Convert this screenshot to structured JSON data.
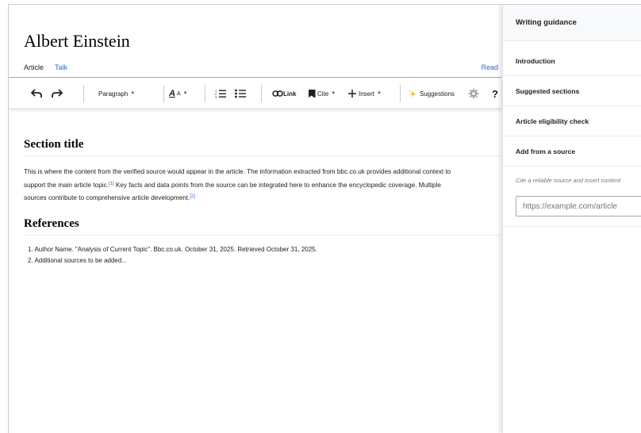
{
  "article": {
    "title": "Albert Einstein",
    "tabs": {
      "article": "Article",
      "talk": "Talk",
      "read": "Read"
    }
  },
  "toolbar": {
    "undo_icon": "undo-icon",
    "redo_icon": "redo-icon",
    "paragraph_label": "Paragraph",
    "text_style_label": "A",
    "text_style_small": "A",
    "link_label": "Link",
    "cite_label": "Cite",
    "insert_label": "Insert",
    "suggestions_label": "Suggestions",
    "help_label": "?"
  },
  "content": {
    "section_title": "Section title",
    "paragraph": {
      "line1": "This is where the content from the verified source would appear in the article. The information extracted from bbc.co.uk provides additional context to",
      "line2_a": "support the main article topic.",
      "ref1": "[1]",
      "line2_b": " Key facts and data points from the source can be integrated here to enhance the encyclopedic coverage. Multiple",
      "line3_a": "sources contribute to comprehensive article development.",
      "ref2": "[2]"
    },
    "references_title": "References",
    "references": [
      "1. Author Name. \"Analysis of Current Topic\". Bbc.co.uk. October 31, 2025. Retrieved October 31, 2025.",
      "2. Additional sources to be added..."
    ]
  },
  "panel": {
    "title": "Writing guidance",
    "items": [
      "Introduction",
      "Suggested sections",
      "Article eligibility check",
      "Add from a source"
    ],
    "hint": "Cite a reliable source and insert content",
    "url_placeholder": "https://example.com/article"
  },
  "colors": {
    "link": "#3366cc",
    "text": "#202122",
    "border": "#a2a9b1",
    "panel_header": "#f8f9fa",
    "suggestions_sparkle": "#f0bc00"
  }
}
